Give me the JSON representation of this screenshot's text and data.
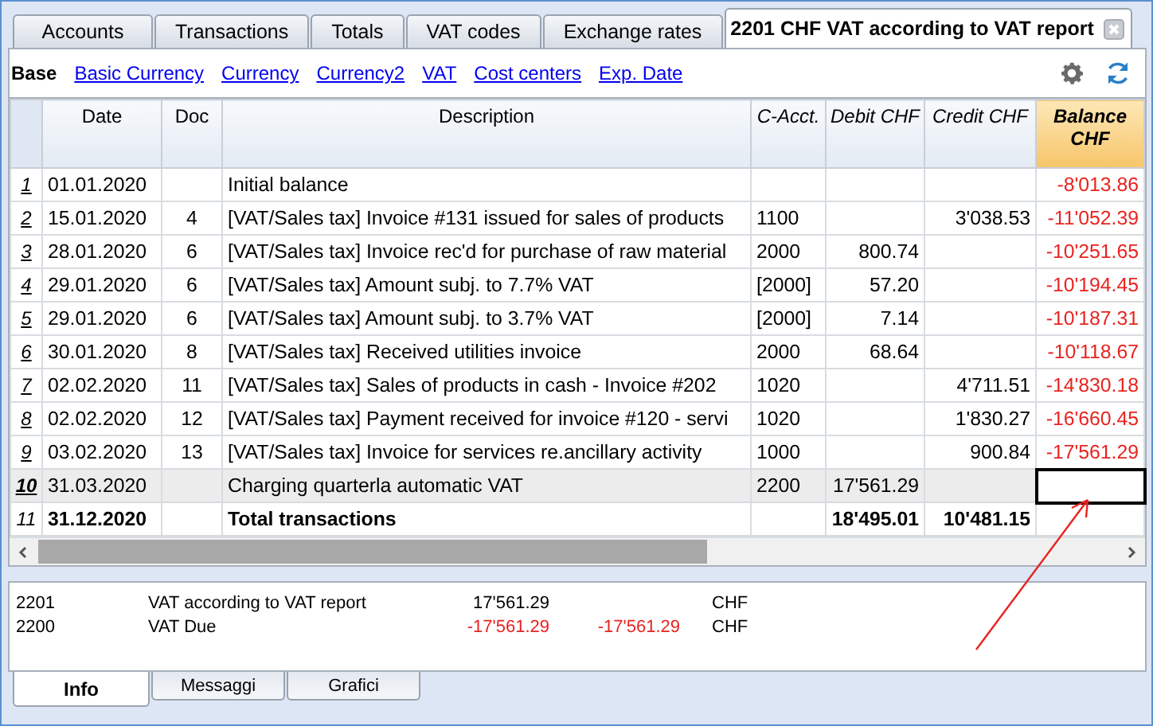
{
  "tabs": [
    {
      "label": "Accounts",
      "selected": false,
      "closable": false
    },
    {
      "label": "Transactions",
      "selected": false,
      "closable": false
    },
    {
      "label": "Totals",
      "selected": false,
      "closable": false
    },
    {
      "label": "VAT codes",
      "selected": false,
      "closable": false
    },
    {
      "label": "Exchange rates",
      "selected": false,
      "closable": false
    },
    {
      "label": "2201 CHF VAT according to VAT report",
      "selected": true,
      "closable": true
    }
  ],
  "views": [
    {
      "label": "Base",
      "selected": true
    },
    {
      "label": "Basic Currency",
      "selected": false
    },
    {
      "label": "Currency",
      "selected": false
    },
    {
      "label": "Currency2",
      "selected": false
    },
    {
      "label": "VAT",
      "selected": false
    },
    {
      "label": "Cost centers",
      "selected": false
    },
    {
      "label": "Exp. Date",
      "selected": false
    }
  ],
  "table": {
    "columns": [
      {
        "label": "Date",
        "selected": false,
        "italic": false
      },
      {
        "label": "Doc",
        "selected": false,
        "italic": false
      },
      {
        "label": "Description",
        "selected": false,
        "italic": false
      },
      {
        "label": "C-Acct.",
        "selected": false,
        "italic": true
      },
      {
        "label": "Debit CHF",
        "selected": false,
        "italic": true
      },
      {
        "label": "Credit CHF",
        "selected": false,
        "italic": true
      },
      {
        "label": "Balance CHF",
        "selected": true,
        "italic": true
      }
    ],
    "rows": [
      {
        "number": "1",
        "selected": false,
        "bold": false,
        "cursor": false,
        "cells": [
          "01.01.2020",
          "",
          "Initial balance",
          "",
          "",
          "",
          "-8'013.86"
        ],
        "balance_negative": true
      },
      {
        "number": "2",
        "selected": false,
        "bold": false,
        "cursor": false,
        "cells": [
          "15.01.2020",
          "4",
          "[VAT/Sales tax] Invoice #131 issued for sales of products",
          "1100",
          "",
          "3'038.53",
          "-11'052.39"
        ],
        "balance_negative": true
      },
      {
        "number": "3",
        "selected": false,
        "bold": false,
        "cursor": false,
        "cells": [
          "28.01.2020",
          "6",
          "[VAT/Sales tax] Invoice rec'd for purchase of raw material",
          "2000",
          "800.74",
          "",
          "-10'251.65"
        ],
        "balance_negative": true
      },
      {
        "number": "4",
        "selected": false,
        "bold": false,
        "cursor": false,
        "cells": [
          "29.01.2020",
          "6",
          "[VAT/Sales tax] Amount subj. to 7.7% VAT",
          "[2000]",
          "57.20",
          "",
          "-10'194.45"
        ],
        "balance_negative": true
      },
      {
        "number": "5",
        "selected": false,
        "bold": false,
        "cursor": false,
        "cells": [
          "29.01.2020",
          "6",
          "[VAT/Sales tax] Amount subj. to 3.7% VAT",
          "[2000]",
          "7.14",
          "",
          "-10'187.31"
        ],
        "balance_negative": true
      },
      {
        "number": "6",
        "selected": false,
        "bold": false,
        "cursor": false,
        "cells": [
          "30.01.2020",
          "8",
          "[VAT/Sales tax] Received utilities invoice",
          "2000",
          "68.64",
          "",
          "-10'118.67"
        ],
        "balance_negative": true
      },
      {
        "number": "7",
        "selected": false,
        "bold": false,
        "cursor": false,
        "cells": [
          "02.02.2020",
          "11",
          "[VAT/Sales tax] Sales of products in cash - Invoice #202",
          "1020",
          "",
          "4'711.51",
          "-14'830.18"
        ],
        "balance_negative": true
      },
      {
        "number": "8",
        "selected": false,
        "bold": false,
        "cursor": false,
        "cells": [
          "02.02.2020",
          "12",
          "[VAT/Sales tax] Payment received for invoice #120 - servi",
          "1020",
          "",
          "1'830.27",
          "-16'660.45"
        ],
        "balance_negative": true
      },
      {
        "number": "9",
        "selected": false,
        "bold": false,
        "cursor": false,
        "cells": [
          "03.02.2020",
          "13",
          "[VAT/Sales tax] Invoice for services re.ancillary activity",
          "1000",
          "",
          "900.84",
          "-17'561.29"
        ],
        "balance_negative": true
      },
      {
        "number": "10",
        "selected": true,
        "bold": false,
        "cursor": true,
        "cells": [
          "31.03.2020",
          "",
          "Charging quarterla automatic VAT",
          "2200",
          "17'561.29",
          "",
          ""
        ],
        "balance_negative": false
      },
      {
        "number": "11",
        "selected": false,
        "bold": true,
        "cursor": false,
        "cells": [
          "31.12.2020",
          "",
          "Total transactions",
          "",
          "18'495.01",
          "10'481.15",
          ""
        ],
        "balance_negative": false
      }
    ]
  },
  "info_lines": [
    {
      "account": "2201",
      "description": "VAT according to VAT report",
      "amount": "17'561.29",
      "currency": "CHF",
      "negative": false
    },
    {
      "account": "2200",
      "description": "VAT Due",
      "amount": "-17'561.29",
      "amount_2": "-17'561.29",
      "currency": "CHF",
      "negative": true
    }
  ],
  "bottom_tabs": [
    {
      "label": "Info",
      "selected": true
    },
    {
      "label": "Messaggi",
      "selected": false
    },
    {
      "label": "Grafici",
      "selected": false
    }
  ]
}
